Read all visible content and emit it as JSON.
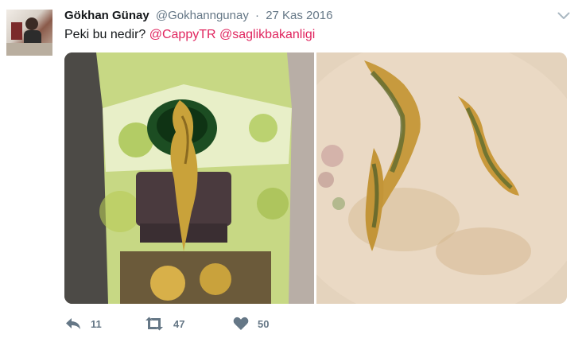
{
  "tweet": {
    "author": {
      "name": "Gökhan Günay",
      "handle": "@Gokhanngunay"
    },
    "separator": "·",
    "date": "27 Kas 2016",
    "text_prefix": "Peki bu nedir? ",
    "mentions": [
      "@CappyTR",
      "@saglikbakanligi"
    ],
    "media": [
      {
        "description_icon": "juice-carton-photo"
      },
      {
        "description_icon": "plate-photo"
      }
    ],
    "actions": {
      "reply_count": "11",
      "retweet_count": "47",
      "like_count": "50"
    }
  },
  "colors": {
    "name": "#14171a",
    "secondary": "#657786",
    "mention": "#e0245e",
    "background": "#ffffff"
  }
}
